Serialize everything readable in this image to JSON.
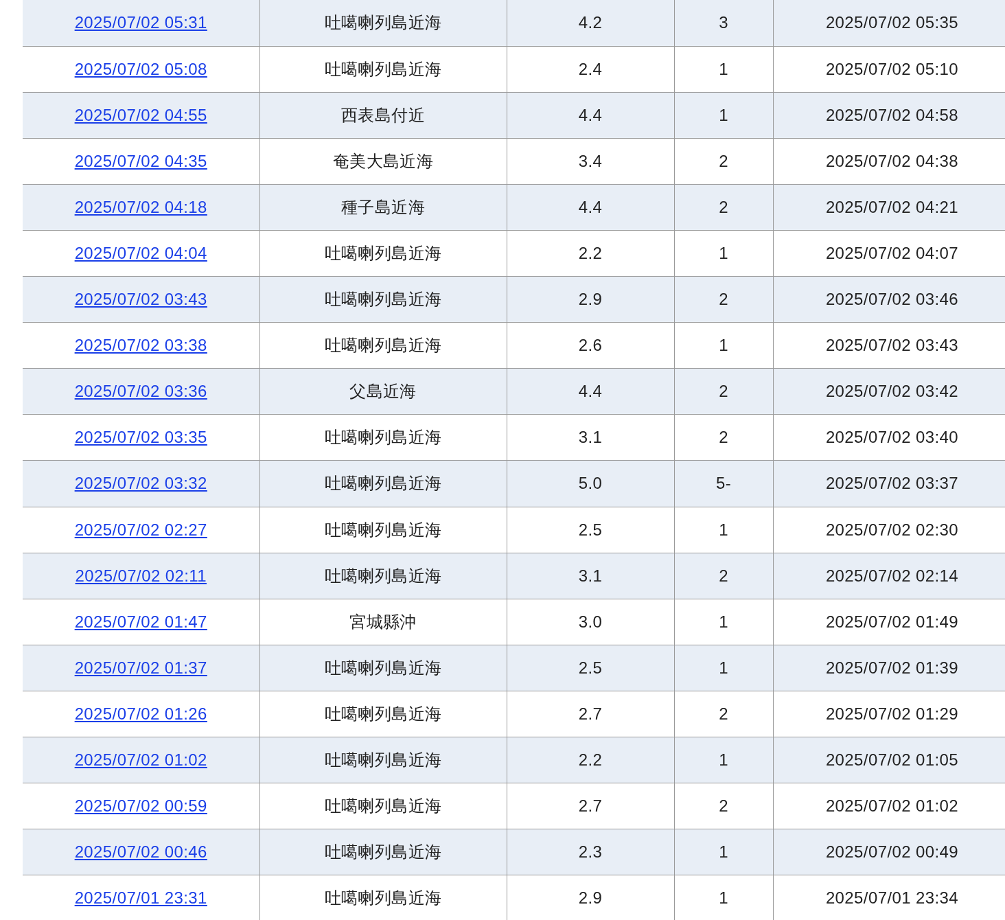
{
  "table": {
    "rows": [
      {
        "time": "2025/07/02 05:31",
        "region": "吐噶喇列島近海",
        "magnitude": "4.2",
        "intensity": "3",
        "announced": "2025/07/02 05:35"
      },
      {
        "time": "2025/07/02 05:08",
        "region": "吐噶喇列島近海",
        "magnitude": "2.4",
        "intensity": "1",
        "announced": "2025/07/02 05:10"
      },
      {
        "time": "2025/07/02 04:55",
        "region": "西表島付近",
        "magnitude": "4.4",
        "intensity": "1",
        "announced": "2025/07/02 04:58"
      },
      {
        "time": "2025/07/02 04:35",
        "region": "奄美大島近海",
        "magnitude": "3.4",
        "intensity": "2",
        "announced": "2025/07/02 04:38"
      },
      {
        "time": "2025/07/02 04:18",
        "region": "種子島近海",
        "magnitude": "4.4",
        "intensity": "2",
        "announced": "2025/07/02 04:21"
      },
      {
        "time": "2025/07/02 04:04",
        "region": "吐噶喇列島近海",
        "magnitude": "2.2",
        "intensity": "1",
        "announced": "2025/07/02 04:07"
      },
      {
        "time": "2025/07/02 03:43",
        "region": "吐噶喇列島近海",
        "magnitude": "2.9",
        "intensity": "2",
        "announced": "2025/07/02 03:46"
      },
      {
        "time": "2025/07/02 03:38",
        "region": "吐噶喇列島近海",
        "magnitude": "2.6",
        "intensity": "1",
        "announced": "2025/07/02 03:43"
      },
      {
        "time": "2025/07/02 03:36",
        "region": "父島近海",
        "magnitude": "4.4",
        "intensity": "2",
        "announced": "2025/07/02 03:42"
      },
      {
        "time": "2025/07/02 03:35",
        "region": "吐噶喇列島近海",
        "magnitude": "3.1",
        "intensity": "2",
        "announced": "2025/07/02 03:40"
      },
      {
        "time": "2025/07/02 03:32",
        "region": "吐噶喇列島近海",
        "magnitude": "5.0",
        "intensity": "5-",
        "announced": "2025/07/02 03:37"
      },
      {
        "time": "2025/07/02 02:27",
        "region": "吐噶喇列島近海",
        "magnitude": "2.5",
        "intensity": "1",
        "announced": "2025/07/02 02:30"
      },
      {
        "time": "2025/07/02 02:11",
        "region": "吐噶喇列島近海",
        "magnitude": "3.1",
        "intensity": "2",
        "announced": "2025/07/02 02:14"
      },
      {
        "time": "2025/07/02 01:47",
        "region": "宮城縣沖",
        "magnitude": "3.0",
        "intensity": "1",
        "announced": "2025/07/02 01:49"
      },
      {
        "time": "2025/07/02 01:37",
        "region": "吐噶喇列島近海",
        "magnitude": "2.5",
        "intensity": "1",
        "announced": "2025/07/02 01:39"
      },
      {
        "time": "2025/07/02 01:26",
        "region": "吐噶喇列島近海",
        "magnitude": "2.7",
        "intensity": "2",
        "announced": "2025/07/02 01:29"
      },
      {
        "time": "2025/07/02 01:02",
        "region": "吐噶喇列島近海",
        "magnitude": "2.2",
        "intensity": "1",
        "announced": "2025/07/02 01:05"
      },
      {
        "time": "2025/07/02 00:59",
        "region": "吐噶喇列島近海",
        "magnitude": "2.7",
        "intensity": "2",
        "announced": "2025/07/02 01:02"
      },
      {
        "time": "2025/07/02 00:46",
        "region": "吐噶喇列島近海",
        "magnitude": "2.3",
        "intensity": "1",
        "announced": "2025/07/02 00:49"
      },
      {
        "time": "2025/07/01 23:31",
        "region": "吐噶喇列島近海",
        "magnitude": "2.9",
        "intensity": "1",
        "announced": "2025/07/01 23:34"
      }
    ]
  }
}
